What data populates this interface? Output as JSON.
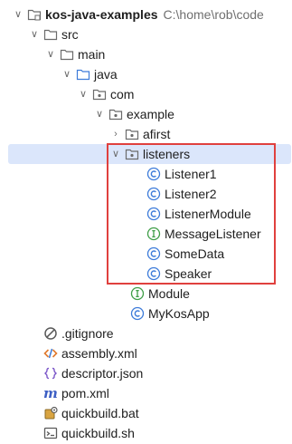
{
  "project": {
    "name": "kos-java-examples",
    "path": "C:\\home\\rob\\code"
  },
  "tree": {
    "src": "src",
    "main": "main",
    "java": "java",
    "com": "com",
    "example": "example",
    "afirst": "afirst",
    "listeners": "listeners",
    "listener_children": [
      "Listener1",
      "Listener2",
      "ListenerModule",
      "MessageListener",
      "SomeData",
      "Speaker"
    ],
    "module": "Module",
    "mykosapp": "MyKosApp",
    "files": [
      ".gitignore",
      "assembly.xml",
      "descriptor.json",
      "pom.xml",
      "quickbuild.bat",
      "quickbuild.sh"
    ]
  },
  "colors": {
    "selection": "#dbe6fb",
    "highlight_border": "#e0403e",
    "class_icon": "#3d7bd9",
    "interface_icon": "#3f9e47",
    "folder_icon": "#6b6b6b"
  }
}
